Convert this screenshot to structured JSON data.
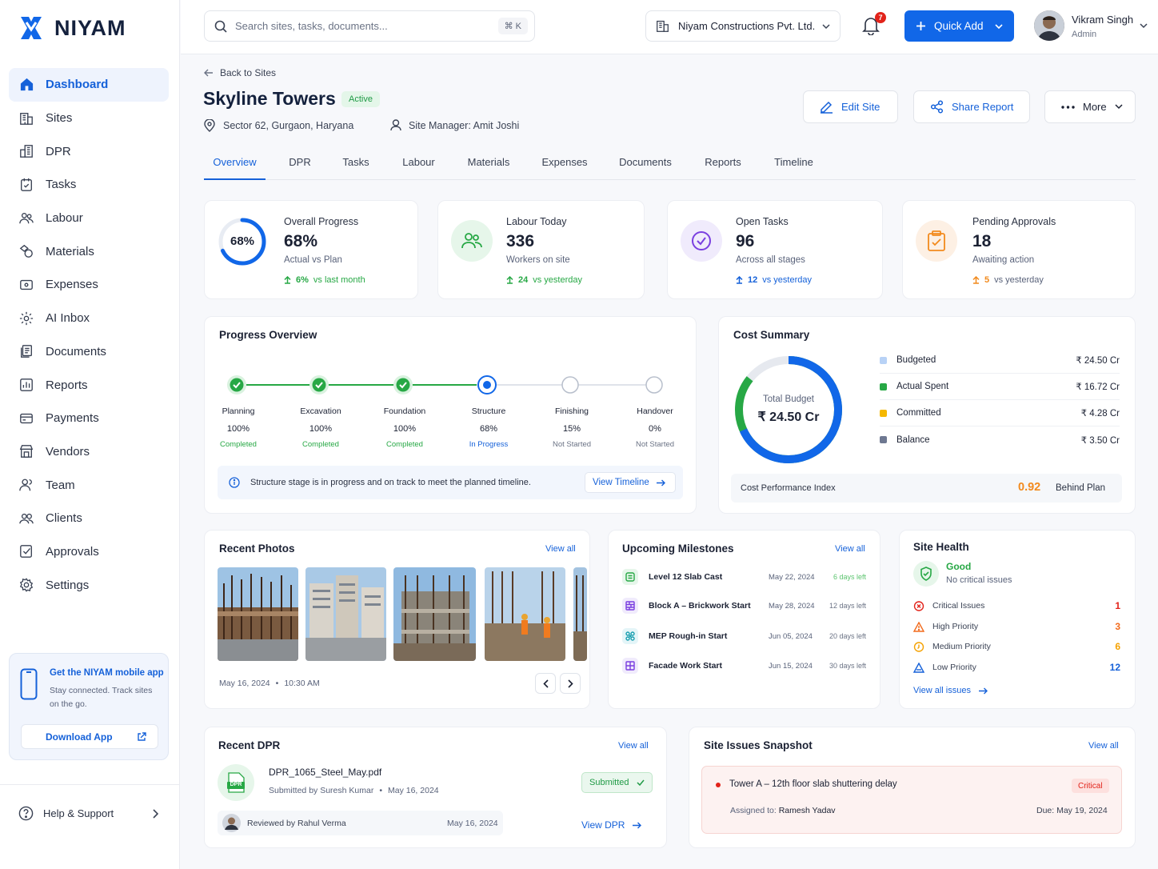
{
  "app": {
    "brand": "NIYAM",
    "brand_color": "#1167e8"
  },
  "sidebar": {
    "items": [
      {
        "label": "Dashboard",
        "icon": "home-icon",
        "active": true
      },
      {
        "label": "Sites",
        "icon": "building-icon"
      },
      {
        "label": "DPR",
        "icon": "report-building-icon"
      },
      {
        "label": "Tasks",
        "icon": "task-check-icon"
      },
      {
        "label": "Labour",
        "icon": "people-icon"
      },
      {
        "label": "Materials",
        "icon": "materials-icon"
      },
      {
        "label": "Expenses",
        "icon": "wallet-icon"
      },
      {
        "label": "AI Inbox",
        "icon": "ai-gear-icon"
      },
      {
        "label": "Documents",
        "icon": "documents-icon"
      },
      {
        "label": "Reports",
        "icon": "chart-icon"
      },
      {
        "label": "Payments",
        "icon": "card-icon"
      },
      {
        "label": "Vendors",
        "icon": "store-icon"
      },
      {
        "label": "Team",
        "icon": "team-icon"
      },
      {
        "label": "Clients",
        "icon": "clients-icon"
      },
      {
        "label": "Approvals",
        "icon": "approve-icon"
      },
      {
        "label": "Settings",
        "icon": "gear-icon"
      }
    ],
    "promo": {
      "title": "Get the NIYAM mobile app",
      "subtitle": "Stay connected. Track sites on the go.",
      "button": "Download App"
    },
    "help": "Help & Support"
  },
  "topbar": {
    "search_placeholder": "Search sites, tasks, documents...",
    "search_shortcut": "⌘ K",
    "company": "Niyam Constructions Pvt. Ltd.",
    "notifications": "7",
    "quick_add": "Quick Add",
    "user_name": "Vikram Singh",
    "user_role": "Admin"
  },
  "site": {
    "back": "Back to Sites",
    "name": "Skyline Towers",
    "status": "Active",
    "location": "Sector 62, Gurgaon, Haryana",
    "manager": "Site Manager: Amit Joshi",
    "actions": {
      "edit": "Edit Site",
      "share": "Share Report",
      "more": "More"
    }
  },
  "tabs": [
    "Overview",
    "DPR",
    "Tasks",
    "Labour",
    "Materials",
    "Expenses",
    "Documents",
    "Reports",
    "Timeline"
  ],
  "stats": [
    {
      "label": "Overall Progress",
      "value": "68%",
      "sub": "Actual vs Plan",
      "trend_value": "6%",
      "trend_text": "vs last month",
      "ring_label": "68%",
      "progress": 0.68
    },
    {
      "label": "Labour Today",
      "value": "336",
      "sub": "Workers on site",
      "trend_value": "24",
      "trend_text": "vs yesterday"
    },
    {
      "label": "Open Tasks",
      "value": "96",
      "sub": "Across all stages",
      "trend_value": "12",
      "trend_text": "vs yesterday"
    },
    {
      "label": "Pending Approvals",
      "value": "18",
      "sub": "Awaiting action",
      "trend_value": "5",
      "trend_text": "vs yesterday"
    }
  ],
  "progress_overview": {
    "title": "Progress Overview",
    "stages": [
      {
        "name": "Planning",
        "pct": "100%",
        "status": "Completed"
      },
      {
        "name": "Excavation",
        "pct": "100%",
        "status": "Completed"
      },
      {
        "name": "Foundation",
        "pct": "100%",
        "status": "Completed"
      },
      {
        "name": "Structure",
        "pct": "68%",
        "status": "In Progress"
      },
      {
        "name": "Finishing",
        "pct": "15%",
        "status": "Not Started"
      },
      {
        "name": "Handover",
        "pct": "0%",
        "status": "Not Started"
      }
    ],
    "note_bold": "Structure stage",
    "note_rest": " is in progress and on track to meet the planned timeline.",
    "view_timeline": "View Timeline"
  },
  "cost_summary": {
    "title": "Cost Summary",
    "center_label": "Total Budget",
    "center_value": "₹ 24.50 Cr",
    "legend": [
      {
        "label": "Budgeted",
        "value": "₹ 24.50 Cr",
        "color": "#b8d2f6"
      },
      {
        "label": "Actual Spent",
        "value": "₹ 16.72 Cr",
        "color": "#27a845"
      },
      {
        "label": "Committed",
        "value": "₹ 4.28 Cr",
        "color": "#f5b800"
      },
      {
        "label": "Balance",
        "value": "₹ 3.50 Cr",
        "color": "#6e7891"
      }
    ],
    "cpi_label": "Cost Performance Index",
    "cpi_value": "0.92",
    "cpi_status": "Behind Plan"
  },
  "photos": {
    "title": "Recent Photos",
    "view_all": "View all",
    "date": "May 16, 2024",
    "time": "10:30 AM"
  },
  "milestones": {
    "title": "Upcoming Milestones",
    "view_all": "View all",
    "items": [
      {
        "name": "Level 12 Slab Cast",
        "date": "May 22, 2024",
        "left": "6 days left"
      },
      {
        "name": "Block A – Brickwork Start",
        "date": "May 28, 2024",
        "left": "12 days left"
      },
      {
        "name": "MEP Rough-in Start",
        "date": "Jun 05, 2024",
        "left": "20 days left"
      },
      {
        "name": "Facade Work Start",
        "date": "Jun 15, 2024",
        "left": "30 days left"
      }
    ]
  },
  "site_health": {
    "title": "Site Health",
    "status": "Good",
    "status_sub": "No critical issues",
    "items": [
      {
        "label": "Critical Issues",
        "count": "1",
        "color": "#e2231a"
      },
      {
        "label": "High Priority",
        "count": "3",
        "color": "#f26b1d"
      },
      {
        "label": "Medium Priority",
        "count": "6",
        "color": "#f5a100"
      },
      {
        "label": "Low Priority",
        "count": "12",
        "color": "#1561d9"
      }
    ],
    "view_all": "View all issues"
  },
  "recent_dpr": {
    "title": "Recent DPR",
    "view_all": "View all",
    "file_tag": "DPR",
    "file": "DPR_1065_Steel_May.pdf",
    "submitted_by": "Submitted by Suresh Kumar",
    "date": "May 16, 2024",
    "status": "Submitted",
    "reviewed_by": "Reviewed by Rahul Verma",
    "reviewed_date": "May 16, 2024",
    "view": "View DPR"
  },
  "issues_snapshot": {
    "title": "Site Issues Snapshot",
    "view_all": "View all",
    "issue": "Tower A – 12th floor slab shuttering delay",
    "severity": "Critical",
    "assigned_label": "Assigned to:",
    "assigned_to": "Ramesh Yadav",
    "due": "Due: May 19, 2024"
  }
}
